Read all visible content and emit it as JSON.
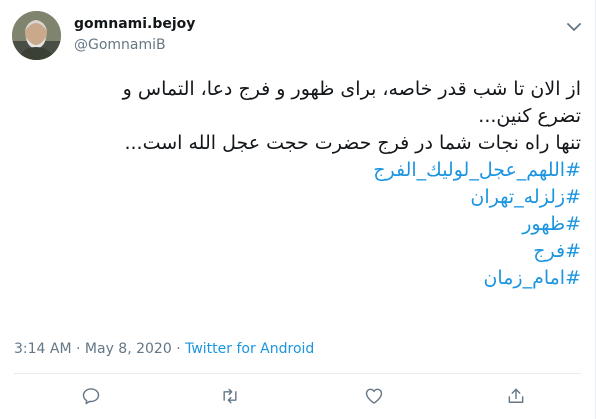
{
  "user": {
    "display_name": "gomnami.bejoy",
    "handle": "@GomnamiB"
  },
  "tweet": {
    "lines": [
      "از الان تا شب قدر خاصه، برای ظهور و فرج دعا، التماس و",
      "تضرع کنین...",
      "تنها راه نجات شما در فرج حضرت حجت عجل الله است..."
    ],
    "hashtags": [
      "#اللهم_عجل_لولیك_الفرج",
      "#زلزله_تهران",
      "#ظهور",
      "#فرج",
      "#امام_زمان"
    ]
  },
  "meta": {
    "time": "3:14 AM",
    "sep1": "·",
    "date": "May 8, 2020",
    "sep2": "·",
    "source": "Twitter for Android"
  },
  "actions": {
    "reply_icon": "reply-icon",
    "retweet_icon": "retweet-icon",
    "like_icon": "heart-icon",
    "share_icon": "share-icon"
  },
  "colors": {
    "link": "#1b95e0",
    "secondary": "#657786",
    "divider": "#e6ecf0"
  }
}
